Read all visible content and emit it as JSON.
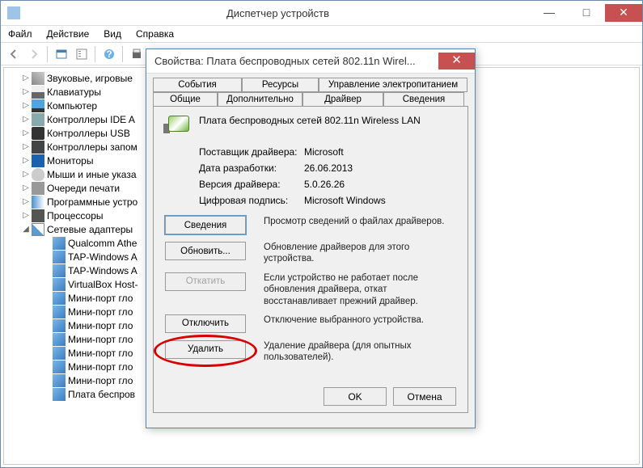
{
  "window": {
    "title": "Диспетчер устройств"
  },
  "menu": {
    "file": "Файл",
    "action": "Действие",
    "view": "Вид",
    "help": "Справка"
  },
  "tree": {
    "items": [
      {
        "label": "Звуковые, игровые",
        "icon": "i-sound",
        "expander": "▷"
      },
      {
        "label": "Клавиатуры",
        "icon": "i-kbd",
        "expander": "▷"
      },
      {
        "label": "Компьютер",
        "icon": "i-pc",
        "expander": "▷"
      },
      {
        "label": "Контроллеры IDE A",
        "icon": "i-ide",
        "expander": "▷"
      },
      {
        "label": "Контроллеры USB",
        "icon": "i-usb",
        "expander": "▷"
      },
      {
        "label": "Контроллеры запом",
        "icon": "i-chip",
        "expander": "▷"
      },
      {
        "label": "Мониторы",
        "icon": "i-monitor",
        "expander": "▷"
      },
      {
        "label": "Мыши и иные указа",
        "icon": "i-mouse",
        "expander": "▷"
      },
      {
        "label": "Очереди печати",
        "icon": "i-print",
        "expander": "▷"
      },
      {
        "label": "Программные устро",
        "icon": "i-soft",
        "expander": "▷"
      },
      {
        "label": "Процессоры",
        "icon": "i-cpu",
        "expander": "▷"
      },
      {
        "label": "Сетевые адаптеры",
        "icon": "i-net",
        "expander": "◢",
        "expanded": true,
        "children": [
          {
            "label": "Qualcomm Athe"
          },
          {
            "label": "TAP-Windows A"
          },
          {
            "label": "TAP-Windows A"
          },
          {
            "label": "VirtualBox Host-"
          },
          {
            "label": "Мини-порт гло"
          },
          {
            "label": "Мини-порт гло"
          },
          {
            "label": "Мини-порт гло"
          },
          {
            "label": "Мини-порт гло"
          },
          {
            "label": "Мини-порт гло"
          },
          {
            "label": "Мини-порт гло"
          },
          {
            "label": "Мини-порт гло"
          },
          {
            "label": "Плата беспров"
          }
        ]
      }
    ]
  },
  "dialog": {
    "title": "Свойства: Плата беспроводных сетей 802.11n Wirel...",
    "tabs": {
      "events": "События",
      "resources": "Ресурсы",
      "power": "Управление электропитанием",
      "general": "Общие",
      "advanced": "Дополнительно",
      "driver": "Драйвер",
      "details": "Сведения"
    },
    "device_name": "Плата беспроводных сетей 802.11n Wireless LAN",
    "info": {
      "provider_label": "Поставщик драйвера:",
      "provider_value": "Microsoft",
      "date_label": "Дата разработки:",
      "date_value": "26.06.2013",
      "version_label": "Версия драйвера:",
      "version_value": "5.0.26.26",
      "signature_label": "Цифровая подпись:",
      "signature_value": "Microsoft Windows"
    },
    "actions": {
      "details_btn": "Сведения",
      "details_desc": "Просмотр сведений о файлах драйверов.",
      "update_btn": "Обновить...",
      "update_desc": "Обновление драйверов для этого устройства.",
      "rollback_btn": "Откатить",
      "rollback_desc": "Если устройство не работает после обновления драйвера, откат восстанавливает прежний драйвер.",
      "disable_btn": "Отключить",
      "disable_desc": "Отключение выбранного устройства.",
      "uninstall_btn": "Удалить",
      "uninstall_desc": "Удаление драйвера (для опытных пользователей)."
    },
    "footer": {
      "ok": "OK",
      "cancel": "Отмена"
    }
  }
}
